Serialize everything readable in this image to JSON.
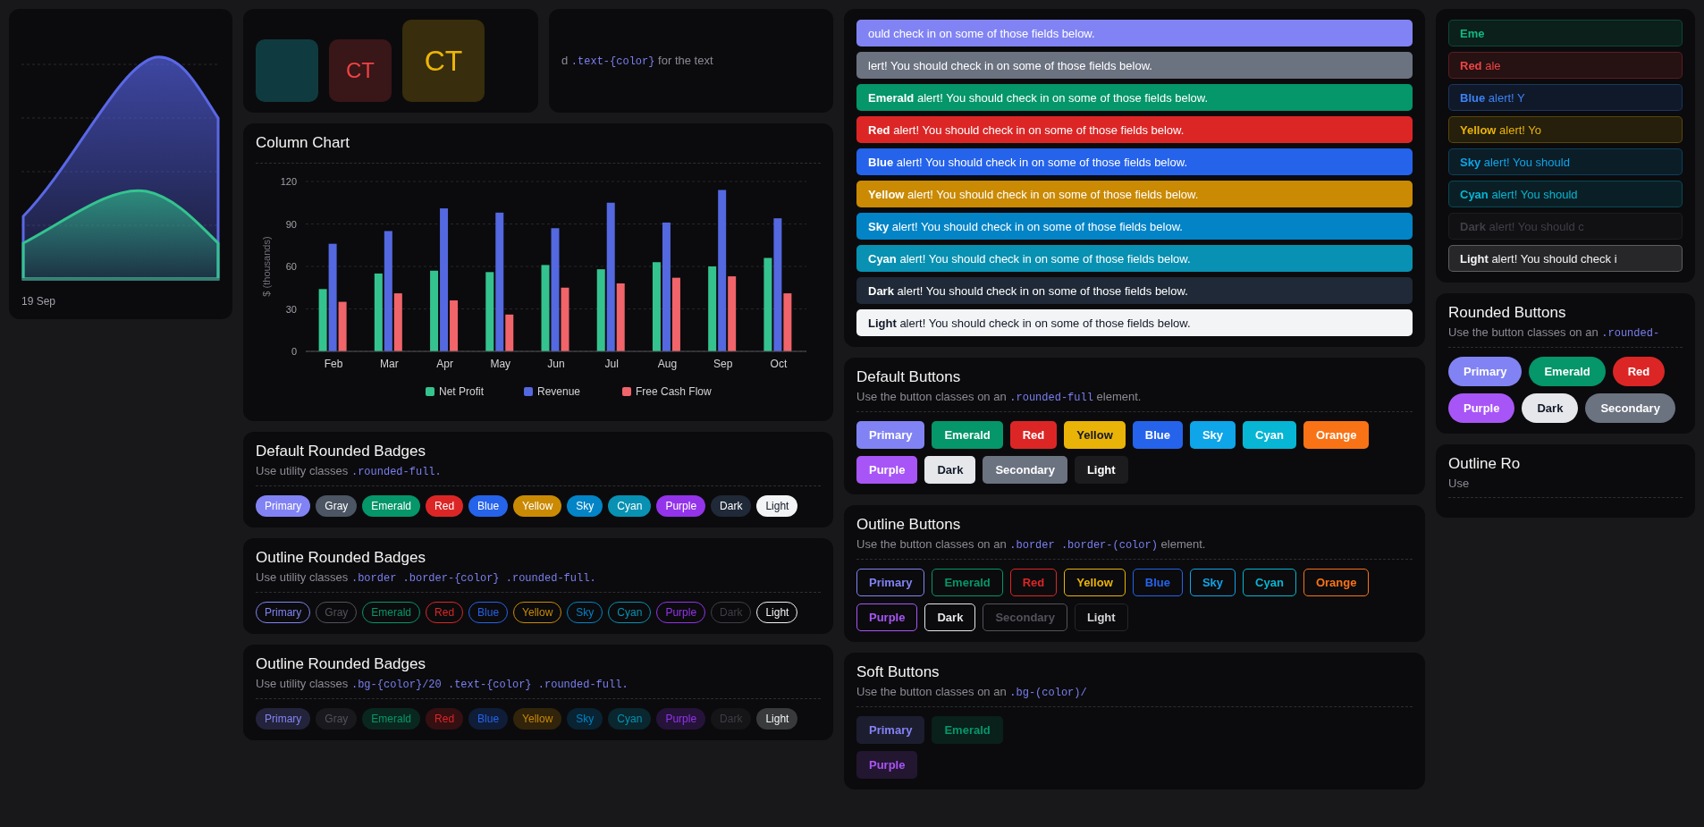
{
  "columns": [
    {
      "cards": [
        {
          "kind": "area",
          "x_label": "19 Sep"
        }
      ]
    },
    {
      "cards": [
        {
          "kind": "row",
          "cards": [
            {
              "kind": "avatars",
              "avatars": [
                {
                  "color": "#0f3b40"
                },
                {
                  "initials": "CT",
                  "color": "#391618"
                },
                {
                  "initials": "CT",
                  "color": "#382d0c"
                }
              ]
            },
            {
              "kind": "note",
              "description": "d",
              "code": ".text-{color}",
              "description_end": "for the text"
            }
          ]
        },
        {
          "kind": "chart",
          "title": "Column Chart",
          "chart_data": {
            "type": "bar",
            "ylabel": "$ (thousands)",
            "categories": [
              "Feb",
              "Mar",
              "Apr",
              "May",
              "Jun",
              "Jul",
              "Aug",
              "Sep",
              "Oct"
            ],
            "series": [
              {
                "name": "Net Profit",
                "color": "#34c38f",
                "values": [
                  44,
                  55,
                  57,
                  56,
                  61,
                  58,
                  63,
                  60,
                  66
                ]
              },
              {
                "name": "Revenue",
                "color": "#5468e0",
                "values": [
                  76,
                  85,
                  101,
                  98,
                  87,
                  105,
                  91,
                  114,
                  94
                ]
              },
              {
                "name": "Free Cash Flow",
                "color": "#f0646a",
                "values": [
                  35,
                  41,
                  36,
                  26,
                  45,
                  48,
                  52,
                  53,
                  41
                ]
              }
            ],
            "ylim": [
              0,
              120
            ],
            "yticks": [
              0,
              30,
              60,
              90,
              120
            ],
            "grid": true,
            "legend": true
          }
        },
        {
          "kind": "badges",
          "title": "Default Rounded Badges",
          "description": "Use utility classes",
          "code": ".rounded-full.",
          "badges": [
            {
              "label": "Primary",
              "color": "#8183f4"
            },
            {
              "label": "Gray",
              "color": "#4b5563"
            },
            {
              "label": "Emerald",
              "color": "#059669"
            },
            {
              "label": "Red",
              "color": "#dc2626"
            },
            {
              "label": "Blue",
              "color": "#2563eb"
            },
            {
              "label": "Yellow",
              "color": "#ca8a04"
            },
            {
              "label": "Sky",
              "color": "#0284c7"
            },
            {
              "label": "Cyan",
              "color": "#0891b2"
            },
            {
              "label": "Purple",
              "color": "#9333ea"
            },
            {
              "label": "Dark",
              "color": "#1f2937"
            },
            {
              "label": "Light",
              "color": "#f3f4f6"
            }
          ]
        },
        {
          "kind": "outlinebadges",
          "title": "Outline Rounded Badges",
          "description": "Use utility classes",
          "code": ".border .border-{color} .rounded-full.",
          "badges": [
            {
              "label": "Primary",
              "color": "#8183f4"
            },
            {
              "label": "Gray",
              "color": "#52525b"
            },
            {
              "label": "Emerald",
              "color": "#059669"
            },
            {
              "label": "Red",
              "color": "#dc2626"
            },
            {
              "label": "Blue",
              "color": "#2563eb"
            },
            {
              "label": "Yellow",
              "color": "#ca8a04"
            },
            {
              "label": "Sky",
              "color": "#0284c7"
            },
            {
              "label": "Cyan",
              "color": "#0891b2"
            },
            {
              "label": "Purple",
              "color": "#9333ea"
            },
            {
              "label": "Dark",
              "color": "#3f3f46"
            },
            {
              "label": "Light",
              "color": "#f3f4f6"
            }
          ]
        },
        {
          "kind": "softbadges",
          "title": "Outline Rounded Badges",
          "description": "Use utility classes",
          "code": ".bg-{color}/20 .text-{color} .rounded-full.",
          "badges": [
            {
              "label": "Primary",
              "color": "#23233b"
            },
            {
              "label": "Gray",
              "color": "#19191d"
            },
            {
              "label": "Emerald",
              "color": "#0a271f"
            },
            {
              "label": "Red",
              "color": "#351012"
            },
            {
              "label": "Blue",
              "color": "#101d39"
            },
            {
              "label": "Yellow",
              "color": "#31240b"
            },
            {
              "label": "Sky",
              "color": "#092332"
            },
            {
              "label": "Cyan",
              "color": "#0a262e"
            },
            {
              "label": "Purple",
              "color": "#261339"
            },
            {
              "label": "Dark",
              "color": "#151518"
            },
            {
              "label": "Light",
              "color": "#393a3c"
            }
          ]
        }
      ]
    },
    {
      "cards": [
        {
          "kind": "alerts",
          "alerts": [
            {
              "text": "ould check in on some of those fields below.",
              "color": "#8183f4"
            },
            {
              "text": "lert! You should check in on some of those fields below.",
              "color": "#6b7280"
            },
            {
              "text": "**Emerald** alert! You should check in on some of those fields below.",
              "color": "#059669"
            },
            {
              "text": "**Red** alert! You should check in on some of those fields below.",
              "color": "#dc2626"
            },
            {
              "text": "**Blue** alert! You should check in on some of those fields below.",
              "color": "#2563eb"
            },
            {
              "text": "**Yellow** alert! You should check in on some of those fields below.",
              "color": "#ca8a04"
            },
            {
              "text": "**Sky** alert! You should check in on some of those fields below.",
              "color": "#0284c7"
            },
            {
              "text": "**Cyan** alert! You should check in on some of those fields below.",
              "color": "#0891b2"
            },
            {
              "text": "**Dark** alert! You should check in on some of those fields below.",
              "color": "#1f2937"
            },
            {
              "text": "**Light** alert! You should check in on some of those fields below.",
              "color": "#f3f4f6"
            }
          ]
        },
        {
          "kind": "buttons",
          "title": "Default Buttons",
          "description": "Use the button classes on an",
          "code": ".rounded-full",
          "description_end": "element.",
          "rows": [
            [
              {
                "label": "Primary",
                "color": "#8183f4"
              },
              {
                "label": "Emerald",
                "color": "#059669"
              },
              {
                "label": "Red",
                "color": "#dc2626"
              },
              {
                "label": "Yellow",
                "color": "#eab308"
              },
              {
                "label": "Blue",
                "color": "#2563eb"
              },
              {
                "label": "Sky",
                "color": "#0ea5e9"
              },
              {
                "label": "Cyan",
                "color": "#06b6d4"
              },
              {
                "label": "Orange",
                "color": "#f97316"
              }
            ],
            [
              {
                "label": "Purple",
                "color": "#a855f7"
              },
              {
                "label": "Dark",
                "color": "#e5e7eb"
              },
              {
                "label": "Secondary",
                "color": "#6b7280"
              },
              {
                "label": "Light",
                "color": "#1c1c1f"
              }
            ]
          ]
        },
        {
          "kind": "outlinebuttons",
          "title": "Outline Buttons",
          "description": "Use the button classes on an",
          "code": ".border .border-(color)",
          "description_end": "element.",
          "rows": [
            [
              {
                "label": "Primary",
                "color": "#8183f4"
              },
              {
                "label": "Emerald",
                "color": "#059669"
              },
              {
                "label": "Red",
                "color": "#dc2626"
              },
              {
                "label": "Yellow",
                "color": "#eab308"
              },
              {
                "label": "Blue",
                "color": "#2563eb"
              },
              {
                "label": "Sky",
                "color": "#0ea5e9"
              },
              {
                "label": "Cyan",
                "color": "#06b6d4"
              },
              {
                "label": "Orange",
                "color": "#f97316"
              }
            ],
            [
              {
                "label": "Purple",
                "color": "#a855f7"
              },
              {
                "label": "Dark",
                "color": "#e5e7eb"
              },
              {
                "label": "Secondary",
                "color": "#52525b"
              },
              {
                "label": "Light",
                "color": "#27272a"
              }
            ]
          ]
        },
        {
          "kind": "softbuttons",
          "title": "Soft Buttons",
          "description": "Use the button classes on an",
          "code": ".bg-(color)/",
          "rows": [
            [
              {
                "label": "Primary",
                "color": "#1d1d30"
              },
              {
                "label": "Emerald",
                "color": "#0a201b"
              }
            ],
            [
              {
                "label": "Purple",
                "color": "#231630"
              }
            ]
          ]
        }
      ]
    },
    {
      "cards": [
        {
          "kind": "softalerts",
          "alerts": [
            {
              "text": "**Eme**",
              "color": "#10b981"
            },
            {
              "text": "**Red** ale",
              "color": "#ef4444"
            },
            {
              "text": "**Blue** alert! Y",
              "color": "#3b82f6"
            },
            {
              "text": "**Yellow** alert! Yo",
              "color": "#eab308"
            },
            {
              "text": "**Sky** alert! You should",
              "color": "#0ea5e9"
            },
            {
              "text": "**Cyan** alert! You should",
              "color": "#06b6d4"
            },
            {
              "text": "**Dark** alert! You should c",
              "color": "#3f3f46"
            },
            {
              "text": "**Light** alert! You should check i",
              "color": "#f4f4f5"
            }
          ]
        },
        {
          "kind": "roundedbuttons",
          "title": "Rounded Buttons",
          "description": "Use the button classes on an",
          "code": ".rounded-",
          "rows": [
            [
              {
                "label": "Primary",
                "color": "#8183f4"
              },
              {
                "label": "Emerald",
                "color": "#059669"
              },
              {
                "label": "Red",
                "color": "#dc2626"
              }
            ],
            [
              {
                "label": "Purple",
                "color": "#a855f7"
              },
              {
                "label": "Dark",
                "color": "#e5e7eb"
              },
              {
                "label": "Secondary",
                "color": "#6b7280"
              }
            ]
          ]
        },
        {
          "kind": "heading",
          "title": "Outline Ro",
          "description": "Use"
        }
      ]
    }
  ]
}
